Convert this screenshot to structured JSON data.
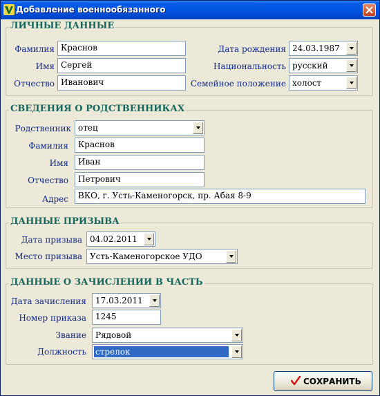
{
  "window": {
    "title": "Добавление военнообязанного"
  },
  "personal": {
    "title": "ЛИЧНЫЕ ДАННЫЕ",
    "surname_label": "Фамилия",
    "surname": "Краснов",
    "name_label": "Имя",
    "name": "Сергей",
    "patronymic_label": "Отчество",
    "patronymic": "Иванович",
    "birthdate_label": "Дата рождения",
    "birthdate": "24.03.1987",
    "nationality_label": "Национальность",
    "nationality": "русский",
    "marital_label": "Семейное положение",
    "marital": "холост"
  },
  "relatives": {
    "title": "СВЕДЕНИЯ О РОДСТВЕННИКАХ",
    "relative_label": "Родственник",
    "relative": "отец",
    "surname_label": "Фамилия",
    "surname": "Краснов",
    "name_label": "Имя",
    "name": "Иван",
    "patronymic_label": "Отчество",
    "patronymic": "Петрович",
    "address_label": "Адрес",
    "address": "ВКО, г. Усть-Каменогорск, пр. Абая 8-9"
  },
  "draft": {
    "title": "ДАННЫЕ ПРИЗЫВА",
    "date_label": "Дата призыва",
    "date": "04.02.2011",
    "place_label": "Место призыва",
    "place": "Усть-Каменогорское УДО"
  },
  "enlistment": {
    "title": "ДАННЫЕ О ЗАЧИСЛЕНИИ В ЧАСТЬ",
    "date_label": "Дата зачисления",
    "date": "17.03.2011",
    "order_label": "Номер приказа",
    "order": "1245",
    "rank_label": "Звание",
    "rank": "Рядовой",
    "position_label": "Должность",
    "position": "стрелок"
  },
  "save_button": {
    "label": "СОХРАНИТЬ"
  },
  "icons": {
    "app": "app-icon",
    "close": "close-icon",
    "save": "checkmark-icon"
  }
}
